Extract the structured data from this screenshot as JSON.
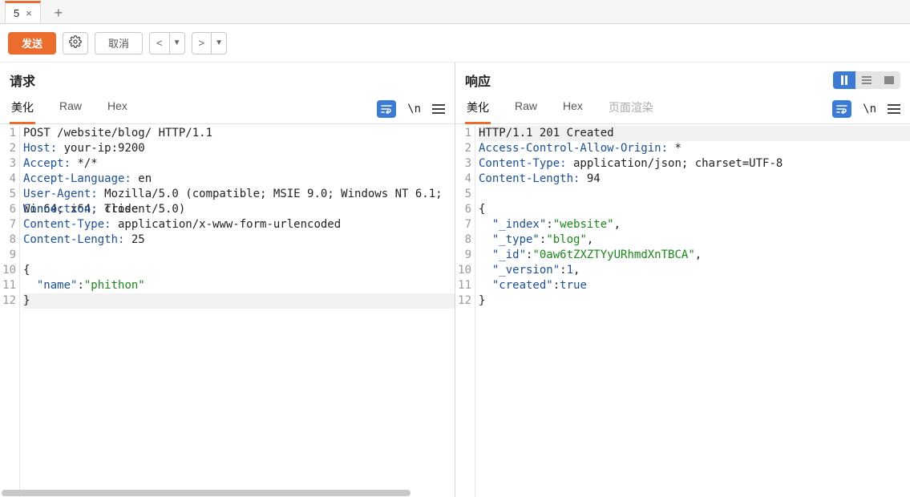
{
  "tabs": {
    "active_label": "5",
    "add_tooltip": "+"
  },
  "actions": {
    "send": "发送",
    "cancel": "取消",
    "back": "<",
    "forward": ">",
    "dropdown": "▼"
  },
  "panes": {
    "request": {
      "title": "请求",
      "subtabs": {
        "pretty": "美化",
        "raw": "Raw",
        "hex": "Hex"
      },
      "lines": [
        [
          {
            "t": "POST /website/blog/ HTTP/1.1",
            "c": ""
          }
        ],
        [
          {
            "t": "Host:",
            "c": "kw"
          },
          {
            "t": " your-ip:9200",
            "c": ""
          }
        ],
        [
          {
            "t": "Accept:",
            "c": "kw"
          },
          {
            "t": " */*",
            "c": ""
          }
        ],
        [
          {
            "t": "Accept-Language:",
            "c": "kw"
          },
          {
            "t": " en",
            "c": ""
          }
        ],
        [
          {
            "t": "User-Agent:",
            "c": "kw"
          },
          {
            "t": " Mozilla/5.0 (compatible; MSIE 9.0; Windows NT 6.1; Win64; x64; Trident/5.0)",
            "c": ""
          }
        ],
        [
          {
            "t": "Connection:",
            "c": "kw"
          },
          {
            "t": " close",
            "c": ""
          }
        ],
        [
          {
            "t": "Content-Type:",
            "c": "kw"
          },
          {
            "t": " application/x-www-form-urlencoded",
            "c": ""
          }
        ],
        [
          {
            "t": "Content-Length:",
            "c": "kw"
          },
          {
            "t": " 25",
            "c": ""
          }
        ],
        [
          {
            "t": "",
            "c": ""
          }
        ],
        [
          {
            "t": "{",
            "c": "punc"
          }
        ],
        [
          {
            "t": "  ",
            "c": ""
          },
          {
            "t": "\"name\"",
            "c": "kw"
          },
          {
            "t": ":",
            "c": "punc"
          },
          {
            "t": "\"phithon\"",
            "c": "str"
          }
        ],
        [
          {
            "t": "}",
            "c": "punc",
            "hl": true
          }
        ]
      ]
    },
    "response": {
      "title": "响应",
      "subtabs": {
        "pretty": "美化",
        "raw": "Raw",
        "hex": "Hex",
        "render": "页面渲染"
      },
      "lines": [
        [
          {
            "t": "HTTP/1.1 201 Created",
            "c": "",
            "hl": true
          }
        ],
        [
          {
            "t": "Access-Control-Allow-Origin:",
            "c": "kw"
          },
          {
            "t": " *",
            "c": ""
          }
        ],
        [
          {
            "t": "Content-Type:",
            "c": "kw"
          },
          {
            "t": " application/json; charset=UTF-8",
            "c": ""
          }
        ],
        [
          {
            "t": "Content-Length:",
            "c": "kw"
          },
          {
            "t": " 94",
            "c": ""
          }
        ],
        [
          {
            "t": "",
            "c": ""
          }
        ],
        [
          {
            "t": "{",
            "c": "punc"
          }
        ],
        [
          {
            "t": "  ",
            "c": ""
          },
          {
            "t": "\"_index\"",
            "c": "kw"
          },
          {
            "t": ":",
            "c": "punc"
          },
          {
            "t": "\"website\"",
            "c": "str"
          },
          {
            "t": ",",
            "c": "punc"
          }
        ],
        [
          {
            "t": "  ",
            "c": ""
          },
          {
            "t": "\"_type\"",
            "c": "kw"
          },
          {
            "t": ":",
            "c": "punc"
          },
          {
            "t": "\"blog\"",
            "c": "str"
          },
          {
            "t": ",",
            "c": "punc"
          }
        ],
        [
          {
            "t": "  ",
            "c": ""
          },
          {
            "t": "\"_id\"",
            "c": "kw"
          },
          {
            "t": ":",
            "c": "punc"
          },
          {
            "t": "\"0aw6tZXZTYyURhmdXnTBCA\"",
            "c": "str"
          },
          {
            "t": ",",
            "c": "punc"
          }
        ],
        [
          {
            "t": "  ",
            "c": ""
          },
          {
            "t": "\"_version\"",
            "c": "kw"
          },
          {
            "t": ":",
            "c": "punc"
          },
          {
            "t": "1",
            "c": "num"
          },
          {
            "t": ",",
            "c": "punc"
          }
        ],
        [
          {
            "t": "  ",
            "c": ""
          },
          {
            "t": "\"created\"",
            "c": "kw"
          },
          {
            "t": ":",
            "c": "punc"
          },
          {
            "t": "true",
            "c": "num"
          }
        ],
        [
          {
            "t": "}",
            "c": "punc"
          }
        ]
      ]
    }
  },
  "tool_labels": {
    "newline": "\\n"
  }
}
